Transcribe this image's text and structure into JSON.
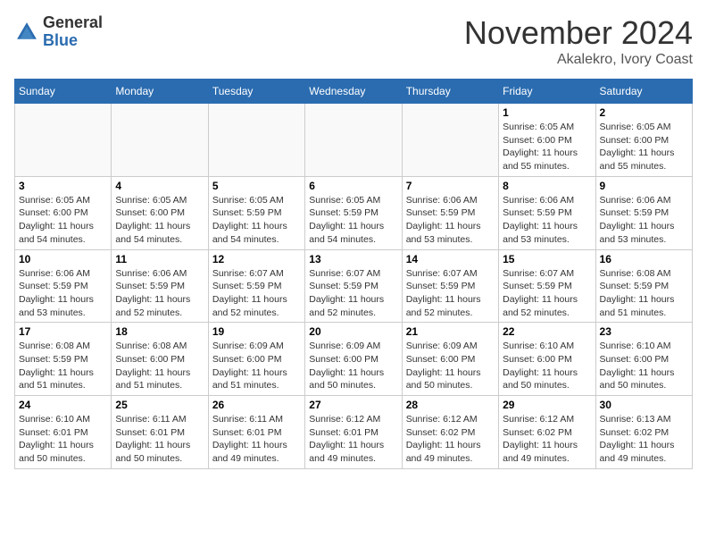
{
  "header": {
    "logo_general": "General",
    "logo_blue": "Blue",
    "month_year": "November 2024",
    "location": "Akalekro, Ivory Coast"
  },
  "weekdays": [
    "Sunday",
    "Monday",
    "Tuesday",
    "Wednesday",
    "Thursday",
    "Friday",
    "Saturday"
  ],
  "weeks": [
    [
      {
        "day": "",
        "info": ""
      },
      {
        "day": "",
        "info": ""
      },
      {
        "day": "",
        "info": ""
      },
      {
        "day": "",
        "info": ""
      },
      {
        "day": "",
        "info": ""
      },
      {
        "day": "1",
        "info": "Sunrise: 6:05 AM\nSunset: 6:00 PM\nDaylight: 11 hours and 55 minutes."
      },
      {
        "day": "2",
        "info": "Sunrise: 6:05 AM\nSunset: 6:00 PM\nDaylight: 11 hours and 55 minutes."
      }
    ],
    [
      {
        "day": "3",
        "info": "Sunrise: 6:05 AM\nSunset: 6:00 PM\nDaylight: 11 hours and 54 minutes."
      },
      {
        "day": "4",
        "info": "Sunrise: 6:05 AM\nSunset: 6:00 PM\nDaylight: 11 hours and 54 minutes."
      },
      {
        "day": "5",
        "info": "Sunrise: 6:05 AM\nSunset: 5:59 PM\nDaylight: 11 hours and 54 minutes."
      },
      {
        "day": "6",
        "info": "Sunrise: 6:05 AM\nSunset: 5:59 PM\nDaylight: 11 hours and 54 minutes."
      },
      {
        "day": "7",
        "info": "Sunrise: 6:06 AM\nSunset: 5:59 PM\nDaylight: 11 hours and 53 minutes."
      },
      {
        "day": "8",
        "info": "Sunrise: 6:06 AM\nSunset: 5:59 PM\nDaylight: 11 hours and 53 minutes."
      },
      {
        "day": "9",
        "info": "Sunrise: 6:06 AM\nSunset: 5:59 PM\nDaylight: 11 hours and 53 minutes."
      }
    ],
    [
      {
        "day": "10",
        "info": "Sunrise: 6:06 AM\nSunset: 5:59 PM\nDaylight: 11 hours and 53 minutes."
      },
      {
        "day": "11",
        "info": "Sunrise: 6:06 AM\nSunset: 5:59 PM\nDaylight: 11 hours and 52 minutes."
      },
      {
        "day": "12",
        "info": "Sunrise: 6:07 AM\nSunset: 5:59 PM\nDaylight: 11 hours and 52 minutes."
      },
      {
        "day": "13",
        "info": "Sunrise: 6:07 AM\nSunset: 5:59 PM\nDaylight: 11 hours and 52 minutes."
      },
      {
        "day": "14",
        "info": "Sunrise: 6:07 AM\nSunset: 5:59 PM\nDaylight: 11 hours and 52 minutes."
      },
      {
        "day": "15",
        "info": "Sunrise: 6:07 AM\nSunset: 5:59 PM\nDaylight: 11 hours and 52 minutes."
      },
      {
        "day": "16",
        "info": "Sunrise: 6:08 AM\nSunset: 5:59 PM\nDaylight: 11 hours and 51 minutes."
      }
    ],
    [
      {
        "day": "17",
        "info": "Sunrise: 6:08 AM\nSunset: 5:59 PM\nDaylight: 11 hours and 51 minutes."
      },
      {
        "day": "18",
        "info": "Sunrise: 6:08 AM\nSunset: 6:00 PM\nDaylight: 11 hours and 51 minutes."
      },
      {
        "day": "19",
        "info": "Sunrise: 6:09 AM\nSunset: 6:00 PM\nDaylight: 11 hours and 51 minutes."
      },
      {
        "day": "20",
        "info": "Sunrise: 6:09 AM\nSunset: 6:00 PM\nDaylight: 11 hours and 50 minutes."
      },
      {
        "day": "21",
        "info": "Sunrise: 6:09 AM\nSunset: 6:00 PM\nDaylight: 11 hours and 50 minutes."
      },
      {
        "day": "22",
        "info": "Sunrise: 6:10 AM\nSunset: 6:00 PM\nDaylight: 11 hours and 50 minutes."
      },
      {
        "day": "23",
        "info": "Sunrise: 6:10 AM\nSunset: 6:00 PM\nDaylight: 11 hours and 50 minutes."
      }
    ],
    [
      {
        "day": "24",
        "info": "Sunrise: 6:10 AM\nSunset: 6:01 PM\nDaylight: 11 hours and 50 minutes."
      },
      {
        "day": "25",
        "info": "Sunrise: 6:11 AM\nSunset: 6:01 PM\nDaylight: 11 hours and 50 minutes."
      },
      {
        "day": "26",
        "info": "Sunrise: 6:11 AM\nSunset: 6:01 PM\nDaylight: 11 hours and 49 minutes."
      },
      {
        "day": "27",
        "info": "Sunrise: 6:12 AM\nSunset: 6:01 PM\nDaylight: 11 hours and 49 minutes."
      },
      {
        "day": "28",
        "info": "Sunrise: 6:12 AM\nSunset: 6:02 PM\nDaylight: 11 hours and 49 minutes."
      },
      {
        "day": "29",
        "info": "Sunrise: 6:12 AM\nSunset: 6:02 PM\nDaylight: 11 hours and 49 minutes."
      },
      {
        "day": "30",
        "info": "Sunrise: 6:13 AM\nSunset: 6:02 PM\nDaylight: 11 hours and 49 minutes."
      }
    ]
  ]
}
